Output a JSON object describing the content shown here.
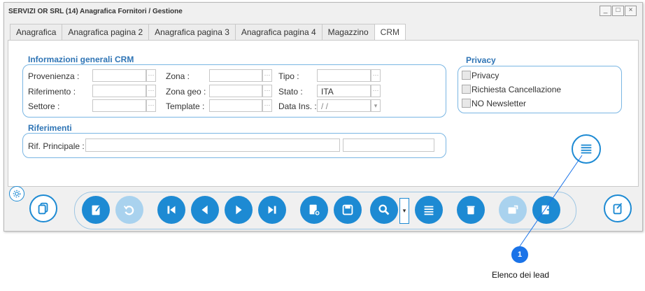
{
  "window": {
    "title": "SERVIZI OR SRL (14) Anagrafica Fornitori / Gestione",
    "controls": [
      "_",
      "□",
      "×"
    ]
  },
  "tabs": [
    {
      "label": "Anagrafica",
      "active": false
    },
    {
      "label": "Anagrafica pagina 2",
      "active": false
    },
    {
      "label": "Anagrafica pagina 3",
      "active": false
    },
    {
      "label": "Anagrafica pagina 4",
      "active": false
    },
    {
      "label": "Magazzino",
      "active": false
    },
    {
      "label": "CRM",
      "active": true
    }
  ],
  "crm": {
    "title": "Informazioni generali CRM",
    "provenienza": {
      "label": "Provenienza :",
      "value": ""
    },
    "riferimento": {
      "label": "Riferimento :",
      "value": ""
    },
    "settore": {
      "label": "Settore :",
      "value": ""
    },
    "zona": {
      "label": "Zona :",
      "value": ""
    },
    "zona_geo": {
      "label": "Zona geo :",
      "value": ""
    },
    "template": {
      "label": "Template :",
      "value": ""
    },
    "tipo": {
      "label": "Tipo :",
      "value": ""
    },
    "stato": {
      "label": "Stato :",
      "value": "ITA"
    },
    "data_ins": {
      "label": "Data Ins. :",
      "value": " /  / "
    }
  },
  "privacy": {
    "title": "Privacy",
    "items": [
      {
        "label": "Privacy",
        "checked": false
      },
      {
        "label": "Richiesta Cancellazione",
        "checked": false
      },
      {
        "label": "NO Newsletter",
        "checked": false
      }
    ]
  },
  "riferimenti": {
    "title": "Riferimenti",
    "principale": {
      "label": "Rif. Principale :",
      "value": "",
      "value2": ""
    }
  },
  "toolbar": {
    "icons": [
      "edit-document-icon",
      "undo-icon",
      "first-record-icon",
      "previous-record-icon",
      "next-record-icon",
      "last-record-icon",
      "new-document-icon",
      "save-icon",
      "search-icon",
      "dropdown-arrow-icon",
      "list-icon",
      "delete-icon",
      "export-icon",
      "export-out-icon"
    ],
    "dropdown_glyph": "▾",
    "accent": "#1d8ad3",
    "disabled": "#a9d2ee"
  },
  "callout": {
    "number": "1",
    "label": "Elenco dei lead",
    "color": "#1a73e8"
  }
}
